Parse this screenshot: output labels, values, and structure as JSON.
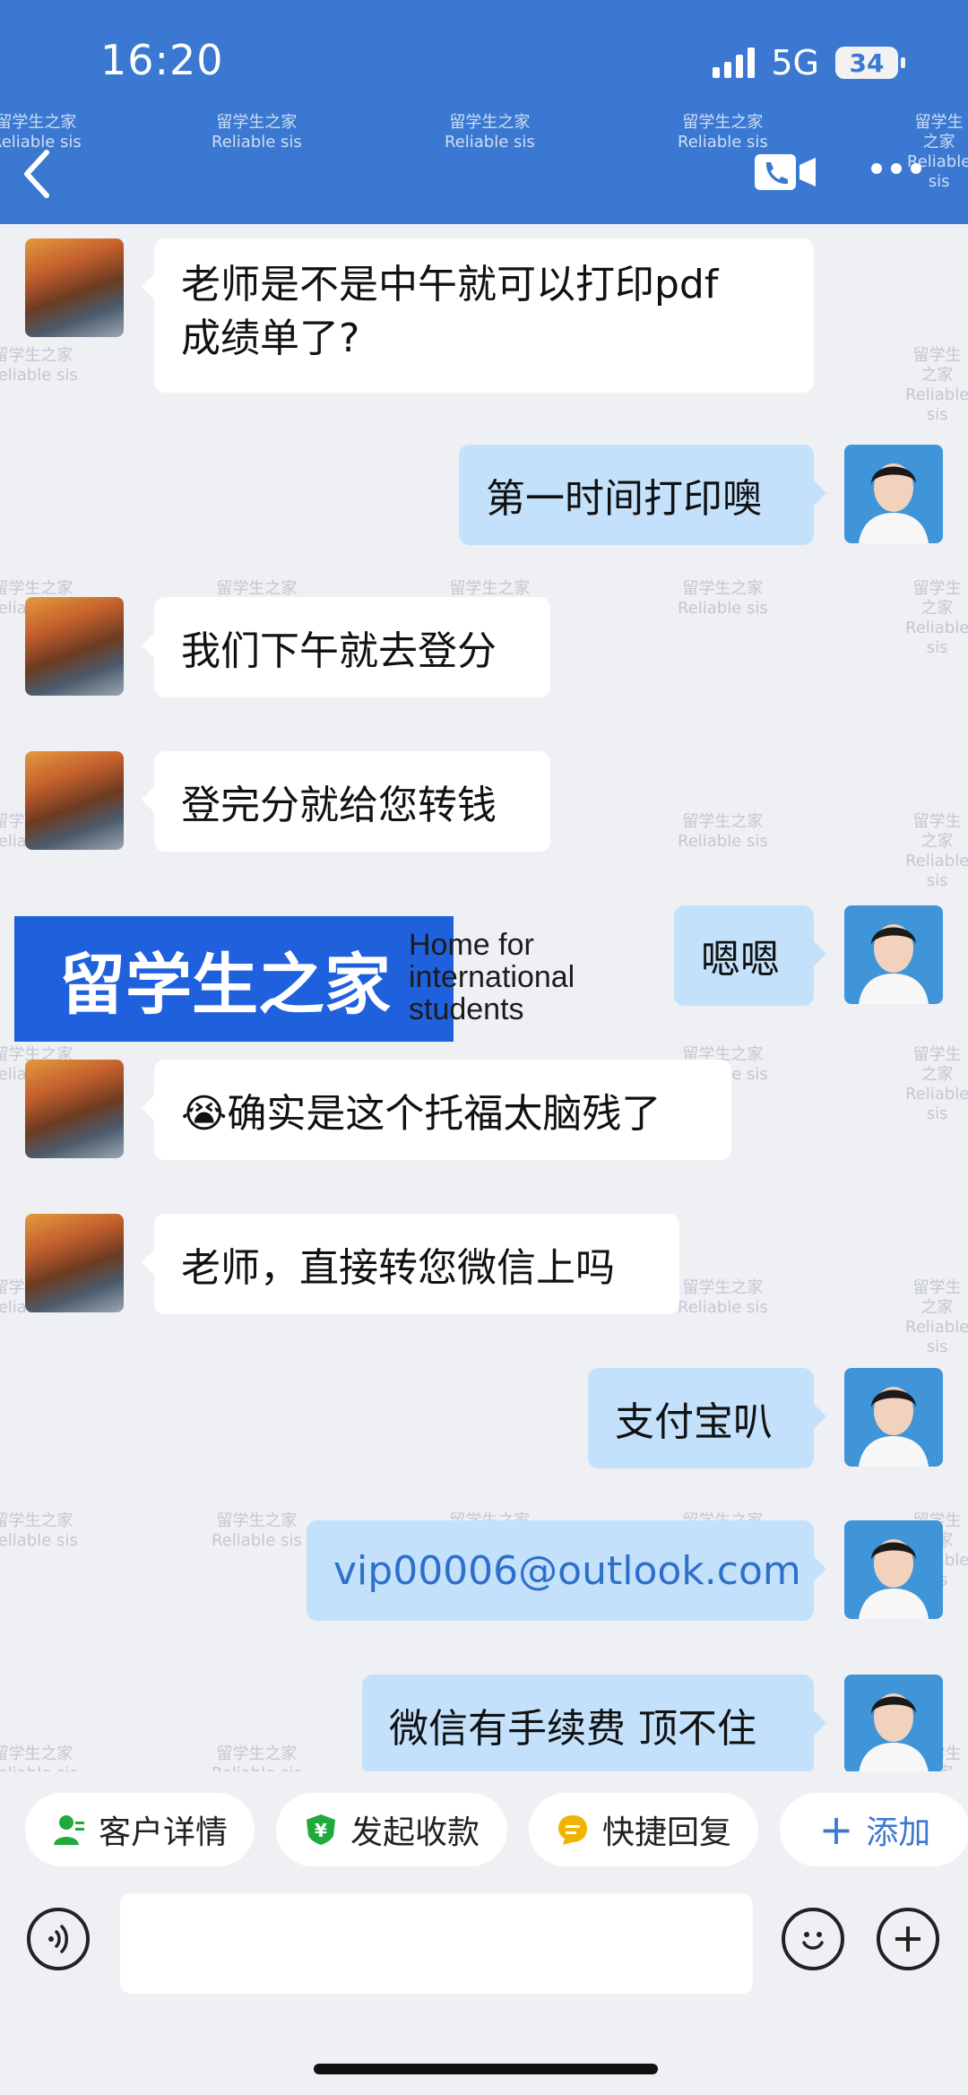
{
  "status_bar": {
    "time": "16:20",
    "network": "5G",
    "battery": "34"
  },
  "watermark": {
    "cn": "留学生之家",
    "en": "Reliable sis"
  },
  "header": {
    "back_icon": "chevron-left-icon",
    "call_icon": "phone-video-icon",
    "more_icon": "more-dots-icon"
  },
  "messages": [
    {
      "side": "in",
      "text": "老师是不是中午就可以打印pdf成绩单了?",
      "line1": "老师是不是中午就可以打印pdf",
      "line2": "成绩单了?"
    },
    {
      "side": "out",
      "text": "第一时间打印噢"
    },
    {
      "side": "in",
      "text": "我们下午就去登分"
    },
    {
      "side": "in",
      "text": "登完分就给您转钱"
    },
    {
      "side": "out",
      "text": "嗯嗯"
    },
    {
      "side": "in",
      "text": "😭确实是这个托福太脑残了"
    },
    {
      "side": "in",
      "text": "老师，直接转您微信上吗"
    },
    {
      "side": "out",
      "text": "支付宝叭"
    },
    {
      "side": "out",
      "text": "vip00006@outlook.com"
    },
    {
      "side": "out",
      "text": "微信有手续费 顶不住"
    }
  ],
  "brand_overlay": {
    "cn": "留学生之家",
    "en_line1": "Home for",
    "en_line2": "international",
    "en_line3": "students"
  },
  "quick_actions": [
    {
      "label": "客户详情",
      "icon": "customer-icon",
      "color": "#1faa3b"
    },
    {
      "label": "发起收款",
      "icon": "yen-shield-icon",
      "color": "#1faa3b"
    },
    {
      "label": "快捷回复",
      "icon": "quick-reply-icon",
      "color": "#f0b400"
    },
    {
      "label": "添加",
      "icon": "plus-icon",
      "color": "#3b78d1"
    }
  ],
  "input": {
    "placeholder": ""
  },
  "colors": {
    "header": "#3b78d1",
    "bubble_out": "#c3e1fb",
    "bubble_in": "#ffffff",
    "background": "#eef0f4"
  }
}
